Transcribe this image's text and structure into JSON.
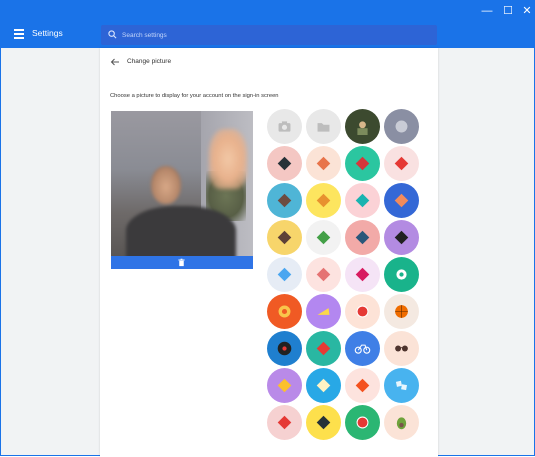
{
  "app": {
    "title": "Settings"
  },
  "window_controls": {
    "minimize": "—",
    "maximize": "☐",
    "close": "✕"
  },
  "search": {
    "placeholder": "Search settings"
  },
  "page": {
    "title": "Change picture",
    "instructions": "Choose a picture to display for your account on the sign-in screen"
  },
  "camera": {
    "delete_icon": "trash-icon"
  },
  "avatars": [
    {
      "name": "take-photo",
      "icon": "camera-icon",
      "bg": "#e8e8e8",
      "fg": "#bdbdbd"
    },
    {
      "name": "choose-file",
      "icon": "folder-icon",
      "bg": "#e8e8e8",
      "fg": "#bdbdbd"
    },
    {
      "name": "profile-photo",
      "icon": "profile-photo",
      "bg": "#3c4a2f",
      "fg": "#7c8b5c"
    },
    {
      "name": "recent-photo",
      "icon": "photo",
      "bg": "#8a8fa3",
      "fg": "#c9ccd6"
    },
    {
      "name": "origami-penguin",
      "icon": "penguin",
      "bg": "#f4c7c3",
      "fg": "#263238"
    },
    {
      "name": "origami-fox",
      "icon": "fox",
      "bg": "#fbe3d6",
      "fg": "#e8744a"
    },
    {
      "name": "origami-turtle",
      "icon": "turtle",
      "bg": "#2bc6a0",
      "fg": "#d6363b"
    },
    {
      "name": "origami-bird",
      "icon": "bird",
      "bg": "#f9e1e1",
      "fg": "#e53935"
    },
    {
      "name": "origami-cat",
      "icon": "cat",
      "bg": "#4fb5d6",
      "fg": "#6d4c41"
    },
    {
      "name": "origami-corgi",
      "icon": "corgi",
      "bg": "#fde55f",
      "fg": "#e8912f"
    },
    {
      "name": "origami-whale",
      "icon": "whale",
      "bg": "#fbd2d6",
      "fg": "#19b3b0"
    },
    {
      "name": "origami-butterfly",
      "icon": "butterfly",
      "bg": "#3468d6",
      "fg": "#f28b5c"
    },
    {
      "name": "origami-moose",
      "icon": "moose",
      "bg": "#f7d56b",
      "fg": "#5d4037"
    },
    {
      "name": "origami-dragon",
      "icon": "dragon",
      "bg": "#f2f2f2",
      "fg": "#43a047"
    },
    {
      "name": "origami-elephant",
      "icon": "elephant",
      "bg": "#f2aaa8",
      "fg": "#29577a"
    },
    {
      "name": "origami-panda",
      "icon": "panda",
      "bg": "#b38be2",
      "fg": "#212121"
    },
    {
      "name": "origami-rainbow",
      "icon": "rainbow",
      "bg": "#e6ecf5",
      "fg": "#4aa6f0"
    },
    {
      "name": "origami-crane",
      "icon": "crane",
      "bg": "#fde3e0",
      "fg": "#e57373"
    },
    {
      "name": "origami-cardinal",
      "icon": "cardinal",
      "bg": "#f5e4f6",
      "fg": "#d81b60"
    },
    {
      "name": "origami-flower",
      "icon": "flower",
      "bg": "#19b38b",
      "fg": "#ffffff"
    },
    {
      "name": "food-pizza-orange",
      "icon": "orange",
      "bg": "#f05a24",
      "fg": "#f9c54b"
    },
    {
      "name": "food-cheese",
      "icon": "cheese",
      "bg": "#b387f0",
      "fg": "#fbd84a"
    },
    {
      "name": "food-watermelon",
      "icon": "watermelon",
      "bg": "#fde3d7",
      "fg": "#e53935"
    },
    {
      "name": "sport-basketball",
      "icon": "basketball",
      "bg": "#f4e9e1",
      "fg": "#ef6c00"
    },
    {
      "name": "music-record",
      "icon": "record",
      "bg": "#1f7fcf",
      "fg": "#212121"
    },
    {
      "name": "sneaker",
      "icon": "sneaker",
      "bg": "#29b7a2",
      "fg": "#e53935"
    },
    {
      "name": "bicycle",
      "icon": "bicycle",
      "bg": "#3f7fe6",
      "fg": "#ffffff"
    },
    {
      "name": "sunglasses",
      "icon": "sunglasses",
      "bg": "#fbe3d7",
      "fg": "#4e342e"
    },
    {
      "name": "french-fries",
      "icon": "fries",
      "bg": "#b98ae8",
      "fg": "#fbc02d"
    },
    {
      "name": "sandwich",
      "icon": "sandwich",
      "bg": "#28a8e6",
      "fg": "#fff3c4"
    },
    {
      "name": "sushi",
      "icon": "sushi",
      "bg": "#fde3de",
      "fg": "#f4511e"
    },
    {
      "name": "ice-cubes",
      "icon": "ice",
      "bg": "#48b3ef",
      "fg": "#e8f6fd"
    },
    {
      "name": "ice-cream",
      "icon": "ice-cream",
      "bg": "#f6d1d1",
      "fg": "#e53935"
    },
    {
      "name": "onigiri",
      "icon": "onigiri",
      "bg": "#fde04c",
      "fg": "#263238"
    },
    {
      "name": "watermelon-slice",
      "icon": "melon",
      "bg": "#2bb673",
      "fg": "#e53935"
    },
    {
      "name": "avocado",
      "icon": "avocado",
      "bg": "#fbe3d7",
      "fg": "#6fa33c"
    }
  ]
}
